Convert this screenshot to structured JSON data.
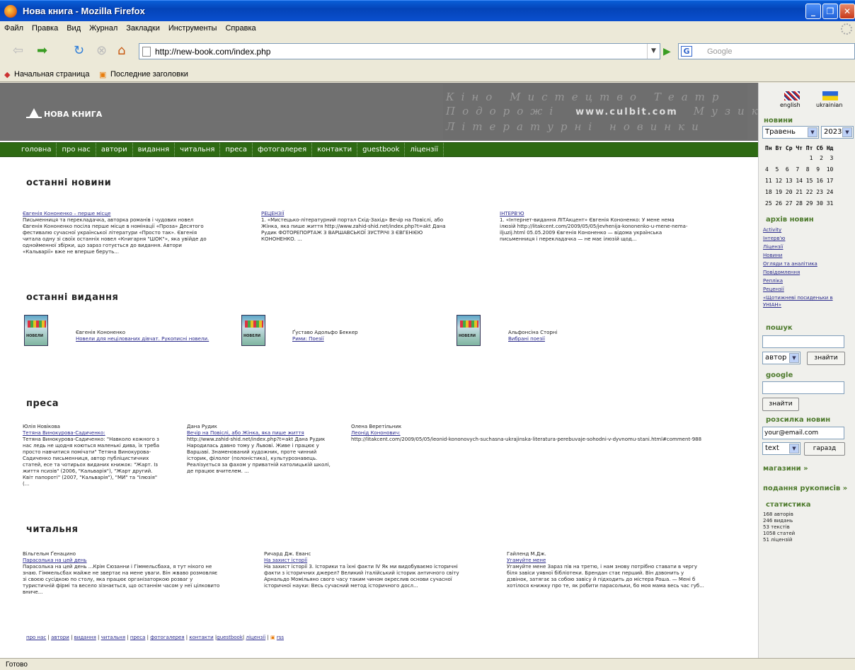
{
  "window": {
    "title": "Нова книга - Mozilla Firefox"
  },
  "menu": [
    "Файл",
    "Правка",
    "Вид",
    "Журнал",
    "Закладки",
    "Инструменты",
    "Справка"
  ],
  "address": {
    "url": "http://new-book.com/index.php",
    "search_placeholder": "Google"
  },
  "bookmarks": [
    "Начальная страница",
    "Последние заголовки"
  ],
  "header": {
    "logo": "НОВА КНИГА",
    "banner_lines": [
      "Кіно  Мистецтво  Театр",
      "Подорожі",
      "Музика",
      "Літературні  новинки"
    ],
    "banner_url": "www.culbit.com"
  },
  "nav": [
    "головна",
    "про нас",
    "автори",
    "видання",
    "читальня",
    "преса",
    "фотогалерея",
    "контакти",
    "guestbook",
    "ліцензії"
  ],
  "news": {
    "title": "останні новини",
    "items": [
      {
        "head": "Євгенія Кононенко – перше місце",
        "text": "Письменниця та перекладачка, авторка романів і чудових новел Євгенія Кононенко посіла перше місце в номінації «Проза» Десятого фестивалю сучасної української літератури «Просто так». Євгенія читала одну зі своїх останніх новел «Книгарня \"ШОК\"», яка увійде до однойменної збірки, що зараз готується до видання. Автори «Кальварії» вже не вперше беруть..."
      },
      {
        "head": "РЕЦЕНЗІЇ",
        "text": "1. «Мистецько-літературний портал Схід-Захід» Вечір на Повіслі, або Жінка, яка пише життя http://www.zahid-shid.net/index.php?t=akt Дана Рудик ФОТОРЕПОРТАЖ З ВАРШАВСЬКОЇ ЗУСТРІЧІ З ЄВГЕНІЄЮ КОНОНЕНКО. ..."
      },
      {
        "head": "ІНТЕРВ'Ю",
        "text": "1. «Інтернет-видання ЛІТАкцент» Євгенія Кононенко: У мене нема ілюзій http://litakcent.com/2009/05/05/jevhenija-kononenko-u-mene-nema-iljuzij.html 05.05.2009 Євгенія Кононенко — відома українська письменниця і перекладачка — не має ілюзій щод..."
      }
    ]
  },
  "editions": {
    "title": "останні видання",
    "items": [
      {
        "author": "Євгенія Кононенко",
        "title": "Новели для нецілованих дівчат. Рукописні новели."
      },
      {
        "author": "Ґуставо Адольфо Беккер",
        "title": "Рими: Поезії"
      },
      {
        "author": "Альфонсіна Сторні",
        "title": "Вибрані поезії"
      }
    ]
  },
  "press": {
    "title": "преса",
    "items": [
      {
        "author": "Юлія Новікова",
        "head": "Тетяна Винокурова-Садиченко:",
        "text": "Тетяна Винокурова-Садиченко: \"Навколо кожного з нас ледь не щодня коються маленькі дива, їх треба просто навчитися помічати\" Тетяна Винокурова-Садиченко письменниця, автор публіцистичних статей, есе та чотирьох виданих книжок: \"Жарт. Із життя псизів\" (2006, \"Кальварія\"), \"Жарт другий. Квіт папороті\" (2007, \"Кальварія\"), \"МИ\" та \"Ілюзія\" (..."
      },
      {
        "author": "Дана Рудик",
        "head": "Вечір на Повіслі, або Жінка, яка пише життя",
        "text": "http://www.zahid-shid.net/index.php?t=akt Дана Рудик Народилась давно тому у Львові. Живе і працює у Варшаві. Знаменований художник, проте чинний історик, філолог (полоністика), культурознавець. Реалізується за фахом у приватній католицькій школі, де працює вчителем. ..."
      },
      {
        "author": "Олена Веретільник",
        "head": "Леонід Кононович:",
        "text": "http://litakcent.com/2009/05/05/leonid-kononovych-suchasna-ukrajinska-literatura-perebuvaje-sohodni-v-dyvnomu-stani.html#comment-988"
      }
    ]
  },
  "reading": {
    "title": "читальня",
    "items": [
      {
        "author": "Вільгельм Ґенацино",
        "head": "Парасолька на цей день",
        "text": "Парасолька на цей день ...Крім Сюзанни і Гіммельсбаха, я тут нікого не знаю. Гіммельсбах майже не звертає на мене уваги. Він жваво розмовляє зі своєю сусідкою по столу, яка працює організаторкою розваг у туристичній фірмі та весело зізнається, що останнім часом у неї цілковито вниче..."
      },
      {
        "author": "Ричард Дж. Еванс",
        "head": "На захист історії",
        "text": "На захист історії 3. Історики та їхні факти IV Як ми видобуваємо історичні факти з історичних джерел? Великий італійський історик античного світу Арнальдо Момільяно свого часу таким чином окреслив основи сучасної історичної науки: Весь сучасний метод історичного досл..."
      },
      {
        "author": "Гайленд М.Дж.",
        "head": "Угамуйте мене",
        "text": "Угамуйте мене Зараз пів на третю, і нам знову потрібно ставати в чергу біля завіси уявної бібліотеки. Брендан стає перший. Він дзвонить у дзвінок, затягає за собою завісу й підходить до містера Роша. — Мені б хотілося книжку про те, як робити парасольки, бо моя мама весь час губ..."
      }
    ]
  },
  "footer": [
    "про нас",
    "автори",
    "видання",
    "читальня",
    "преса",
    "фотогалерея",
    "контакти",
    "guestbook",
    "ліцензії",
    "rss"
  ],
  "sidebar": {
    "lang": [
      "english",
      "ukrainian"
    ],
    "news_title": "новини",
    "month": "Травень",
    "year": "2023",
    "cal_head": "Пн Вт Ср Чт Пт Сб Нд",
    "cal_rows": [
      "             1  2  3",
      "4  5  6  7  8  9  10",
      "11 12 13 14 15 16 17",
      "18 19 20 21 22 23 24",
      "25 26 27 28 29 30 31"
    ],
    "archive_title": "архів новин",
    "archive": [
      "Activity",
      "Інтерв'ю",
      "Ліцензії",
      "Новини",
      "Огляди та аналітика",
      "Повідомлення",
      "Репліка",
      "Рецензії",
      "«Щотижневі посиденьки в УНІАН»"
    ],
    "search_title": "пошук",
    "search_select": "автор",
    "search_btn": "знайти",
    "google_title": "google",
    "google_btn": "знайти",
    "mail_title": "розсилка новин",
    "mail_value": "your@email.com",
    "mail_select": "text",
    "mail_btn": "гаразд",
    "shops": "магазини »",
    "manuscripts": "подання рукописів »",
    "stats_title": "статистика",
    "stats": [
      "168 авторів",
      "246 видань",
      "53 текстів",
      "1058 статей",
      "51 ліцензій"
    ]
  },
  "status": "Готово"
}
